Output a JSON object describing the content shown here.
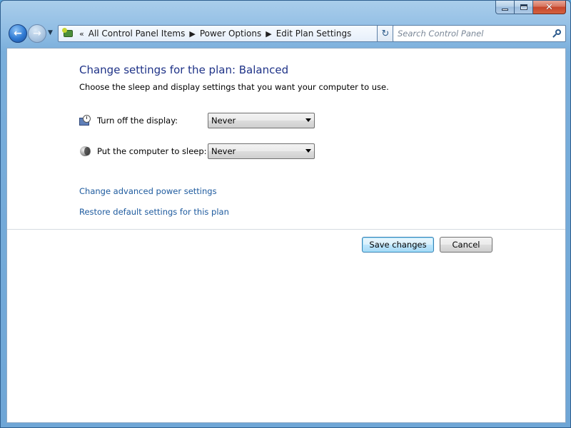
{
  "window": {
    "caption": {
      "minimize_icon": "minimize-icon",
      "maximize_icon": "maximize-icon",
      "close_glyph": "✕"
    }
  },
  "nav": {
    "back_glyph": "←",
    "forward_glyph": "→",
    "recent_glyph": "▼",
    "breadcrumb": {
      "overflow": "«",
      "items": [
        "All Control Panel Items",
        "Power Options",
        "Edit Plan Settings"
      ],
      "separator": "▶"
    },
    "address_dropdown_glyph": "▼",
    "refresh_glyph": "↻",
    "search": {
      "placeholder": "Search Control Panel"
    }
  },
  "page": {
    "title": "Change settings for the plan: Balanced",
    "subtitle": "Choose the sleep and display settings that you want your computer to use.",
    "settings": [
      {
        "label": "Turn off the display:",
        "value": "Never",
        "icon": "display-clock-icon"
      },
      {
        "label": "Put the computer to sleep:",
        "value": "Never",
        "icon": "sleep-moon-icon"
      }
    ],
    "links": {
      "advanced": "Change advanced power settings",
      "restore": "Restore default settings for this plan"
    },
    "buttons": {
      "save": "Save changes",
      "cancel": "Cancel"
    }
  },
  "colors": {
    "title": "#1e3287",
    "link": "#1d5a9e",
    "window_frame": "#79aedb"
  }
}
